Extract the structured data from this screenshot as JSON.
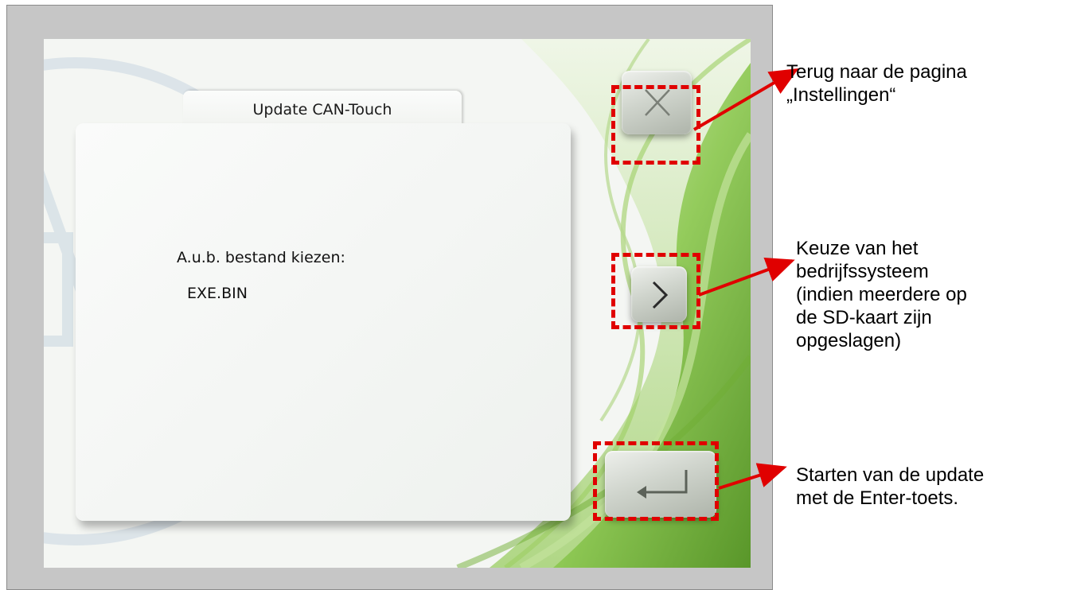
{
  "dialog": {
    "title": "Update CAN-Touch",
    "prompt": "A.u.b. bestand kiezen:",
    "selected_file": "EXE.BIN"
  },
  "buttons": {
    "close": {
      "icon": "close-icon"
    },
    "next": {
      "icon": "chevron-right-icon"
    },
    "enter": {
      "icon": "enter-icon"
    }
  },
  "annotations": {
    "close": "Terug naar de pagina\n„Instellingen“",
    "next": "Keuze van het\nbedrijfssysteem\n(indien meerdere op\nde SD-kaart zijn\nopgeslagen)",
    "enter": "Starten van de update\nmet de Enter-toets."
  },
  "colors": {
    "highlight": "#e00000",
    "accent_green": "#7cb83a",
    "frame_gray": "#c6c6c6"
  }
}
